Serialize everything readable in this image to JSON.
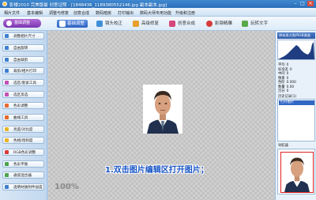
{
  "window": {
    "title": "影楼2010 完美版最 创意证照 - [1848436_1189380552146.jpg 副本副本.jpg]",
    "min_label": "–",
    "max_label": "□",
    "close_label": "×"
  },
  "menu": [
    "相片文件",
    "基本编辑",
    "调整与修复",
    "创意合成",
    "数码暗房",
    "打印输出",
    "数码大师专用功能",
    "升级和注册"
  ],
  "toolbar": {
    "main_label": "基础调整",
    "buttons": [
      {
        "label": "基础调整",
        "active": true
      },
      {
        "label": "镜头校正",
        "active": false
      },
      {
        "label": "高级修复",
        "active": false
      },
      {
        "label": "创意合成",
        "active": false
      },
      {
        "label": "影钢精雕",
        "active": false
      },
      {
        "label": "玩转文字",
        "active": false
      }
    ]
  },
  "sidebar": {
    "items": [
      "调整相片尺寸",
      "自由旋转",
      "自由裁剪",
      "裁剪/相片打印",
      "选区/套索工具",
      "选区反选",
      "色彩调整",
      "曲线工具",
      "亮度/对比度",
      "色相/饱和度",
      "RGB色彩调整",
      "色彩平衡",
      "通道混合器",
      "透明材质附件加度"
    ]
  },
  "canvas": {
    "instruction": "1.双击图片编辑区打开图片；",
    "zoom": "100%"
  },
  "right_panel": {
    "header": "原始直方图/RGB通道",
    "stats": [
      {
        "label": "平均",
        "value": "0"
      },
      {
        "label": "标准差",
        "value": "0"
      },
      {
        "label": "中间",
        "value": "0"
      },
      {
        "label": "像素",
        "value": "0"
      },
      {
        "label": "色阶",
        "value": "0.000"
      },
      {
        "label": "数量",
        "value": "0.00"
      },
      {
        "label": "百分",
        "value": "0"
      }
    ],
    "history_label": "历史记录",
    "history_count": "(1)",
    "history_entry": "打开图片",
    "navigator_label": "导航器"
  },
  "colors": {
    "accent": "#2f62c2",
    "instruction": "#1753c6",
    "nav_frame": "#e02020"
  }
}
